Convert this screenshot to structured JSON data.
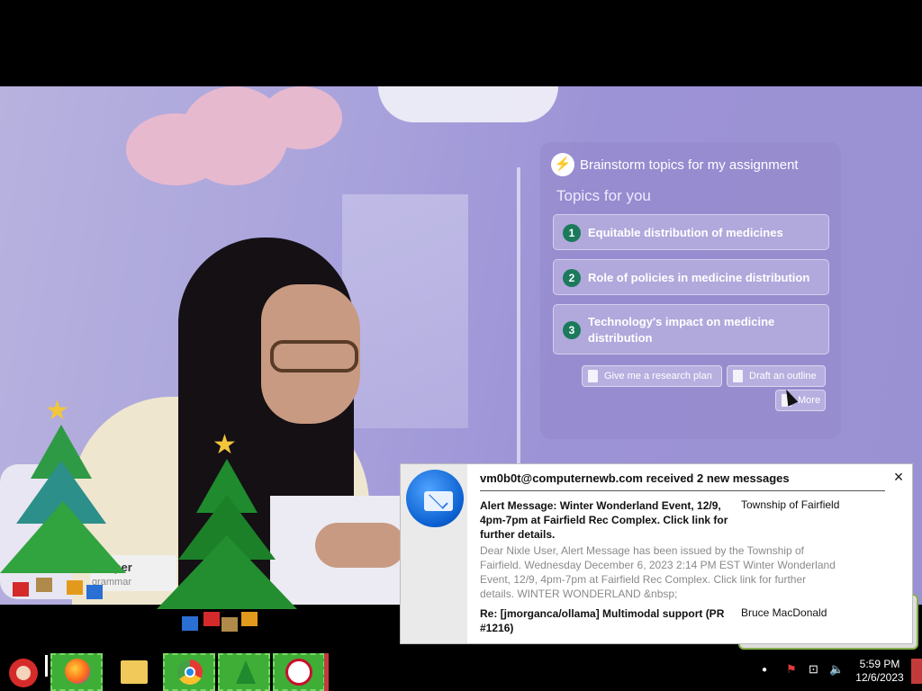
{
  "ai_panel": {
    "title": "Brainstorm topics for my assignment",
    "subtitle": "Topics for you",
    "topics": [
      {
        "num": "1",
        "text": "Equitable distribution of medicines"
      },
      {
        "num": "2",
        "text": "Role of policies in medicine distribution"
      },
      {
        "num": "3",
        "text": "Technology's impact on medicine distribution"
      }
    ],
    "actions": {
      "research_plan": "Give me a research plan",
      "draft_outline": "Draft an outline",
      "more": "More"
    }
  },
  "notification": {
    "title": "vm0b0t@computernewb.com received 2 new messages",
    "close": "×",
    "messages": [
      {
        "subject": "Alert Message: Winter Wonderland Event, 12/9, 4pm-7pm at Fairfield Rec Complex. Click link for further details.",
        "from": "Township of Fairfield",
        "preview": "Dear Nixle User, Alert Message has been issued by the Township of Fairfield. Wednesday December 6, 2023 2:14 PM EST Winter Wonderland Event, 12/9, 4pm-7pm at Fairfield Rec Complex. Click link for further details. WINTER WONDERLAND &nbsp;"
      },
      {
        "subject": "Re: [jmorganca/ollama] Multimodal support (PR #1216)",
        "from": "Bruce MacDonald"
      }
    ]
  },
  "overlay_label": {
    "line1": "r Paper",
    "line2": "grammar"
  },
  "taskbar": {
    "apps": [
      "santa-app",
      "firefox",
      "file-explorer",
      "chrome",
      "tree-app",
      "mcafee"
    ],
    "time": "5:59 PM",
    "date": "12/6/2023"
  },
  "colors": {
    "accent_green": "#3fae37",
    "topic_badge": "#1c7a5c",
    "thunderbird_blue": "#0a5fd0",
    "video_bg": "#a9a3dc"
  }
}
